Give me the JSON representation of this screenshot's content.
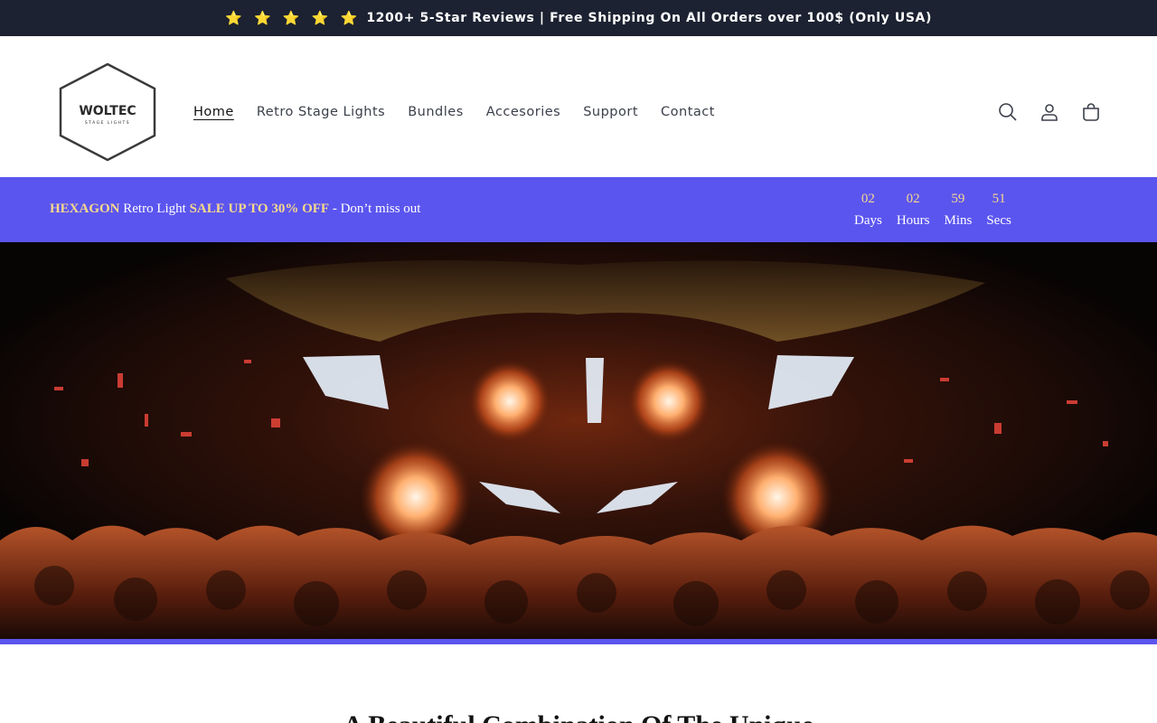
{
  "announcement": {
    "stars": "⭐ ⭐ ⭐ ⭐ ⭐",
    "text": "1200+ 5-Star Reviews | Free Shipping On All Orders over 100$ (Only USA)"
  },
  "header": {
    "logo": {
      "brand": "WOLTEC",
      "tagline": "STAGE LIGHTS"
    },
    "nav": [
      {
        "label": "Home",
        "active": true
      },
      {
        "label": "Retro Stage Lights",
        "active": false
      },
      {
        "label": "Bundles",
        "active": false
      },
      {
        "label": "Accesories",
        "active": false
      },
      {
        "label": "Support",
        "active": false
      },
      {
        "label": "Contact",
        "active": false
      }
    ],
    "icons": [
      "search-icon",
      "account-icon",
      "cart-icon"
    ]
  },
  "promo": {
    "highlight_1": "HEXAGON",
    "text_1": " Retro Light ",
    "highlight_2": "SALE UP TO 30% OFF",
    "text_2": " - Don’t miss out",
    "countdown": [
      {
        "value": "02",
        "label": "Days"
      },
      {
        "value": "02",
        "label": "Hours"
      },
      {
        "value": "59",
        "label": "Mins"
      },
      {
        "value": "51",
        "label": "Secs"
      }
    ]
  },
  "section": {
    "title": "A Beautiful Combination Of The Unique"
  },
  "colors": {
    "announcement_bg": "#1c2231",
    "promo_bg": "#5b55ef",
    "promo_highlight": "#f7d98c",
    "star": "#f5c518"
  }
}
